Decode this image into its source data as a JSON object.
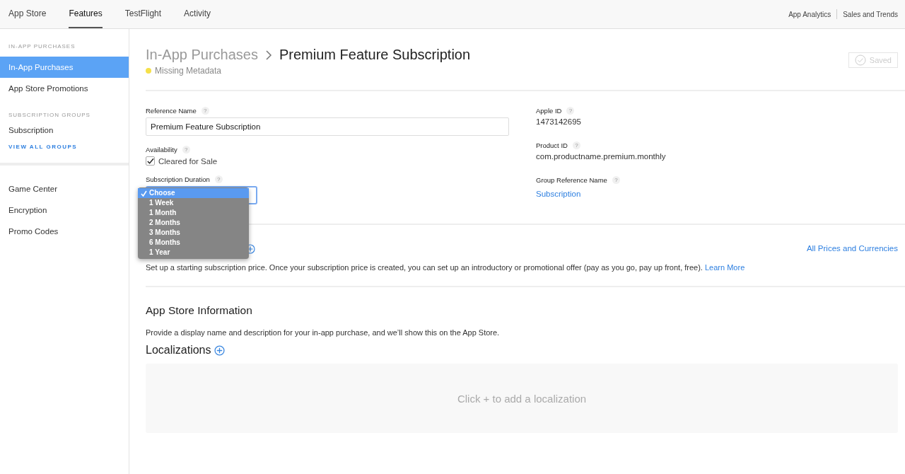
{
  "top_nav": {
    "tabs": [
      {
        "label": "App Store",
        "selected": false
      },
      {
        "label": "Features",
        "selected": true
      },
      {
        "label": "TestFlight",
        "selected": false
      },
      {
        "label": "Activity",
        "selected": false
      }
    ],
    "links": [
      "App Analytics",
      "Sales and Trends"
    ]
  },
  "sidebar": {
    "groups": [
      {
        "heading": "IN-APP PURCHASES",
        "items": [
          {
            "label": "In-App Purchases",
            "selected": true
          },
          {
            "label": "App Store Promotions",
            "selected": false
          }
        ]
      },
      {
        "heading": "SUBSCRIPTION GROUPS",
        "items": [
          {
            "label": "Subscription",
            "selected": false
          }
        ],
        "link": "VIEW ALL GROUPS"
      }
    ],
    "bottom_items": [
      {
        "label": "Game Center",
        "selected": false
      },
      {
        "label": "Encryption",
        "selected": false
      },
      {
        "label": "Promo Codes",
        "selected": false
      }
    ]
  },
  "header": {
    "breadcrumb": "In-App Purchases",
    "title": "Premium Feature Subscription",
    "status": {
      "label": "Missing Metadata",
      "color": "#f5e04a"
    },
    "save_button": {
      "label": "Saved",
      "disabled": true
    }
  },
  "form": {
    "reference_name": {
      "label": "Reference Name",
      "help": "?",
      "value": "Premium Feature Subscription"
    },
    "availability": {
      "label": "Availability",
      "help": "?",
      "option": "Cleared for Sale",
      "checked": true
    },
    "duration": {
      "label": "Subscription Duration",
      "help": "?",
      "options": [
        {
          "label": "Choose",
          "selected": true
        },
        {
          "label": "1 Week",
          "selected": false
        },
        {
          "label": "1 Month",
          "selected": false
        },
        {
          "label": "2 Months",
          "selected": false
        },
        {
          "label": "3 Months",
          "selected": false
        },
        {
          "label": "6 Months",
          "selected": false
        },
        {
          "label": "1 Year",
          "selected": false
        }
      ]
    },
    "apple_id": {
      "label": "Apple ID",
      "help": "?",
      "value": "1473142695"
    },
    "product_id": {
      "label": "Product ID",
      "help": "?",
      "value": "com.productname.premium.monthly"
    },
    "group_reference": {
      "label": "Group Reference Name",
      "help": "?",
      "value": "Subscription"
    }
  },
  "pricing": {
    "link": "All Prices and Currencies",
    "description": "Set up a starting subscription price. Once your subscription price is created, you can set up an introductory or promotional offer (pay as you go, pay up front, free).",
    "learn_more": "Learn More"
  },
  "app_store_information": {
    "title": "App Store Information",
    "description": "Provide a display name and description for your in-app purchase, and we’ll show this on the App Store.",
    "localizations_title": "Localizations",
    "empty_message": "Click + to add a localization"
  }
}
